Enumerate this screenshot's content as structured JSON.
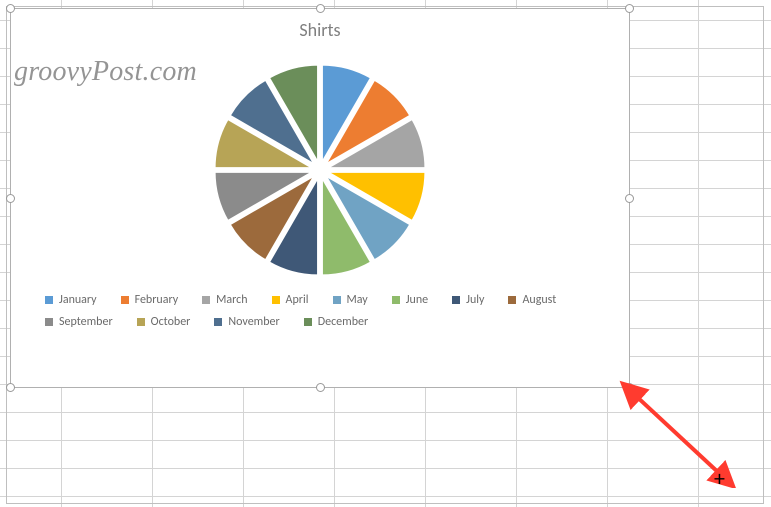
{
  "watermark": "groovyPost.com",
  "chart_data": {
    "type": "pie",
    "title": "Shirts",
    "categories": [
      "January",
      "February",
      "March",
      "April",
      "May",
      "June",
      "July",
      "August",
      "September",
      "October",
      "November",
      "December"
    ],
    "values": [
      1,
      1,
      1,
      1,
      1,
      1,
      1,
      1,
      1,
      1,
      1,
      1
    ],
    "series_colors": [
      "#5b9bd5",
      "#ed7d31",
      "#a5a5a5",
      "#ffc000",
      "#70ad47",
      "#9e480e",
      "#636363",
      "#997300",
      "#4472c4",
      "#70ad47",
      "#5b9bd5",
      "#43682b"
    ]
  },
  "colors": {
    "slices": [
      "#5b9bd5",
      "#ed7d31",
      "#a5a5a5",
      "#ffc000",
      "#70a3c4",
      "#8fbb6b",
      "#3f5877",
      "#9c6a3c",
      "#8b8b8b",
      "#b7a456",
      "#4f6f8f",
      "#6b8e5a"
    ],
    "legend": [
      "#5b9bd5",
      "#ed7d31",
      "#a5a5a5",
      "#ffc000",
      "#70a3c4",
      "#8fbb6b",
      "#3f5877",
      "#9c6a3c",
      "#8b8b8b",
      "#b7a456",
      "#4f6f8f",
      "#6b8e5a"
    ]
  },
  "legend": {
    "items": [
      {
        "label": "January"
      },
      {
        "label": "February"
      },
      {
        "label": "March"
      },
      {
        "label": "April"
      },
      {
        "label": "May"
      },
      {
        "label": "June"
      },
      {
        "label": "July"
      },
      {
        "label": "August"
      },
      {
        "label": "September"
      },
      {
        "label": "October"
      },
      {
        "label": "November"
      },
      {
        "label": "December"
      }
    ]
  },
  "annotation": {
    "cursor": "+"
  }
}
